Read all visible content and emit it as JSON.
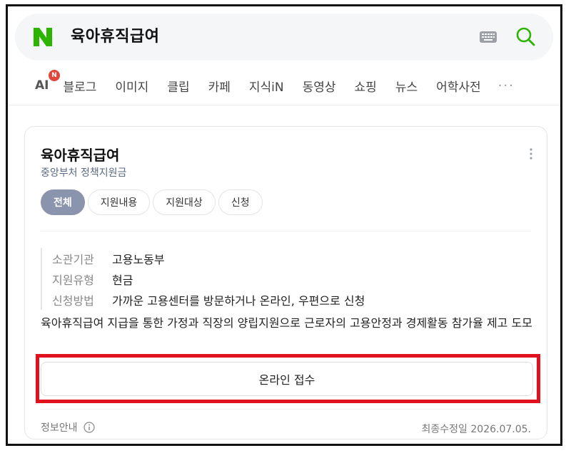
{
  "search": {
    "query": "육아휴직급여",
    "logo_letter": "N",
    "logo_color": "#2db400",
    "keyboard_icon": "keyboard-icon",
    "search_icon": "search-icon"
  },
  "tabs": {
    "ai": "AI",
    "ai_badge": "N",
    "items": [
      "블로그",
      "이미지",
      "클립",
      "카페",
      "지식iN",
      "동영상",
      "쇼핑",
      "뉴스",
      "어학사전"
    ],
    "more": "···"
  },
  "card": {
    "title": "육아휴직급여",
    "subtitle": "중앙부처 정책지원금",
    "chips": [
      "전체",
      "지원내용",
      "지원대상",
      "신청"
    ],
    "active_chip": "전체",
    "info": [
      {
        "key": "소관기관",
        "value": "고용노동부"
      },
      {
        "key": "지원유형",
        "value": "현금"
      },
      {
        "key": "신청방법",
        "value": "가까운 고용센터를 방문하거나 온라인, 우편으로 신청"
      }
    ],
    "description": "육아휴직급여 지급을 통한 가정과 직장의 양립지원으로 근로자의 고용안정과 경제활동 참가율 제고 도모",
    "apply_button": "온라인 접수",
    "footer_left": "정보안내",
    "footer_right": "최종수정일 2026.07.05."
  },
  "colors": {
    "highlight": "#e0101c",
    "active_chip": "#8a94ad",
    "search_accent": "#2db400"
  }
}
